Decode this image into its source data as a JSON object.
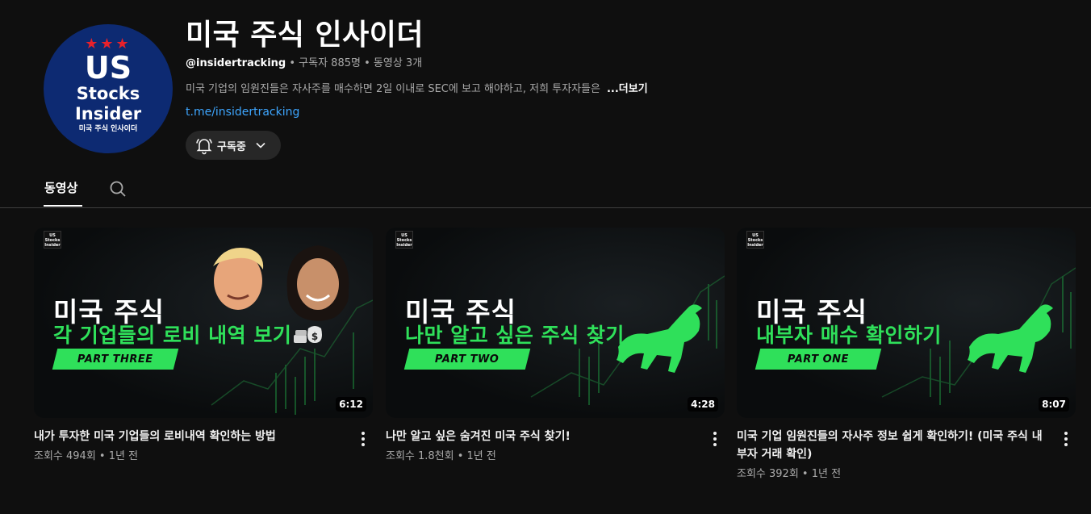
{
  "channel": {
    "avatar": {
      "stars": "★★★",
      "line1": "US",
      "line2": "Stocks",
      "line3": "Insider",
      "line4": "미국 주식 인사이더"
    },
    "title": "미국 주식 인사이더",
    "handle": "@insidertracking",
    "subscribers": "구독자 885명",
    "video_count": "동영상 3개",
    "separator": "•",
    "description": "미국 기업의 임원진들은 자사주를 매수하면 2일 이내로 SEC에 보고 해야하고, 저희 투자자들은",
    "more_label": "...더보기",
    "link": "t.me/insidertracking",
    "subscribe_label": "구독중"
  },
  "tabs": {
    "videos_label": "동영상"
  },
  "videos": [
    {
      "thumb_line1": "미국 주식",
      "thumb_line2": "각 기업들의 로비 내역 보기",
      "thumb_part": "PART THREE",
      "duration": "6:12",
      "title": "내가 투자한 미국 기업들의 로비내역 확인하는 방법",
      "meta": "조회수 494회 • 1년 전"
    },
    {
      "thumb_line1": "미국 주식",
      "thumb_line2": "나만 알고 싶은 주식 찾기",
      "thumb_part": "PART TWO",
      "duration": "4:28",
      "title": "나만 알고 싶은 숨겨진 미국 주식 찾기!",
      "meta": "조회수 1.8천회 • 1년 전"
    },
    {
      "thumb_line1": "미국 주식",
      "thumb_line2": "내부자 매수 확인하기",
      "thumb_part": "PART ONE",
      "duration": "8:07",
      "title": "미국 기업 임원진들의 자사주 정보 쉽게 확인하기!  (미국 주식 내부자 거래 확인)",
      "meta": "조회수 392회 • 1년 전"
    }
  ],
  "thumb_logo": {
    "line1": "US",
    "line2": "Stocks",
    "line3": "Insider"
  },
  "colors": {
    "background": "#0f0f0f",
    "accent_green": "#2fe05a",
    "link_blue": "#3ea6ff",
    "avatar_blue": "#0d2a72",
    "star_red": "#e8212b"
  }
}
